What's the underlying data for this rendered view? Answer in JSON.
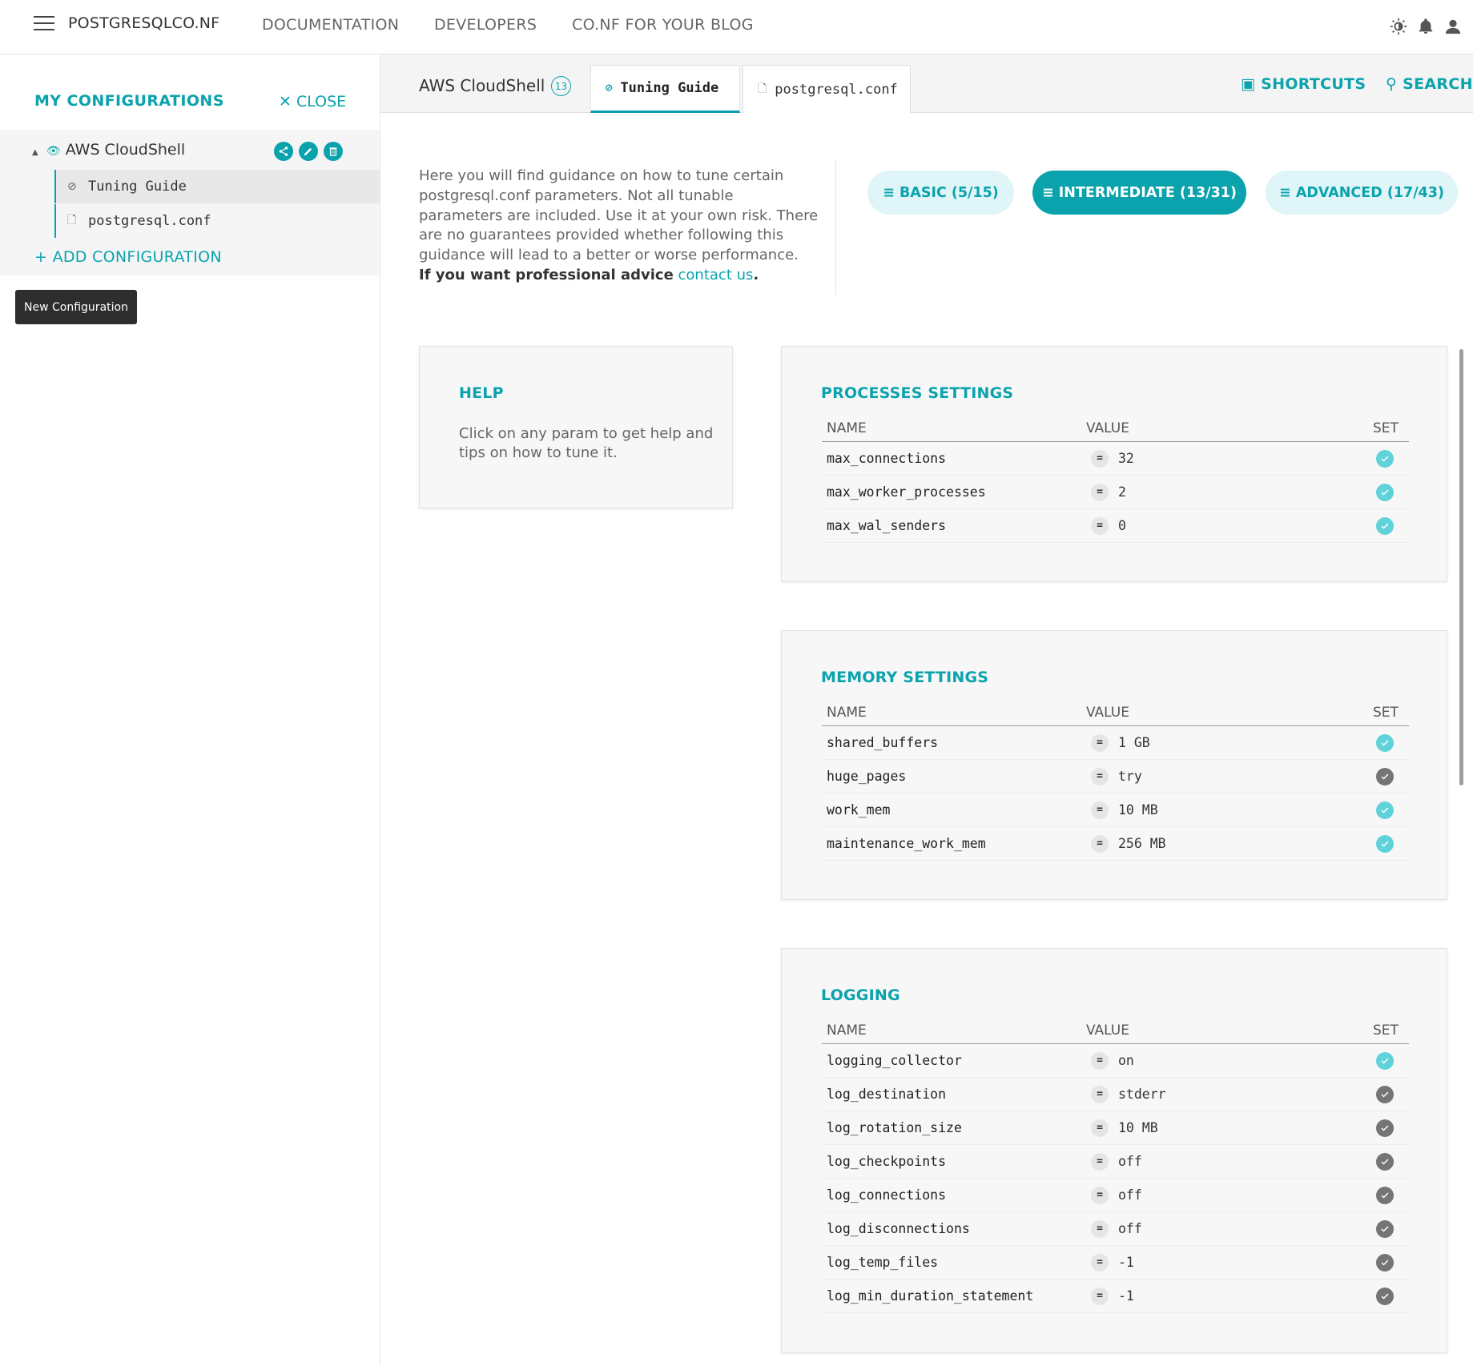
{
  "header": {
    "brand": "POSTGRESQLCO.NF",
    "nav": [
      "DOCUMENTATION",
      "DEVELOPERS",
      "CO.NF FOR YOUR BLOG"
    ]
  },
  "sidebar": {
    "title": "MY CONFIGURATIONS",
    "close_label": "CLOSE",
    "config_name": "AWS CloudShell",
    "children": [
      "Tuning Guide",
      "postgresql.conf"
    ],
    "add_label": "ADD CONFIGURATION",
    "tooltip": "New Configuration"
  },
  "tabs": {
    "config_title": "AWS CloudShell",
    "badge": "13",
    "items": [
      "Tuning Guide",
      "postgresql.conf"
    ],
    "shortcuts": "SHORTCUTS",
    "search": "SEARCH"
  },
  "intro": {
    "text": "Here you will find guidance on how to tune certain postgresql.conf parameters. Not all tunable parameters are included. Use it at your own risk. There are no guarantees provided whether following this guidance will lead to a better or worse performance.",
    "advice": "If you want professional advice",
    "contact": "contact us",
    "period": "."
  },
  "levels": [
    "BASIC (5/15)",
    "INTERMEDIATE (13/31)",
    "ADVANCED (17/43)"
  ],
  "help": {
    "title": "HELP",
    "text": "Click on any param to get help and tips on how to tune it."
  },
  "columns": {
    "name": "NAME",
    "value": "VALUE",
    "set": "SET"
  },
  "sections": [
    {
      "title": "PROCESSES SETTINGS",
      "rows": [
        {
          "name": "max_connections",
          "value": "32",
          "set": "teal"
        },
        {
          "name": "max_worker_processes",
          "value": "2",
          "set": "teal"
        },
        {
          "name": "max_wal_senders",
          "value": "0",
          "set": "teal"
        }
      ]
    },
    {
      "title": "MEMORY SETTINGS",
      "rows": [
        {
          "name": "shared_buffers",
          "value": "1 GB",
          "set": "teal"
        },
        {
          "name": "huge_pages",
          "value": "try",
          "set": "gray"
        },
        {
          "name": "work_mem",
          "value": "10 MB",
          "set": "teal"
        },
        {
          "name": "maintenance_work_mem",
          "value": "256 MB",
          "set": "teal"
        }
      ]
    },
    {
      "title": "LOGGING",
      "rows": [
        {
          "name": "logging_collector",
          "value": "on",
          "set": "teal"
        },
        {
          "name": "log_destination",
          "value": "stderr",
          "set": "gray"
        },
        {
          "name": "log_rotation_size",
          "value": "10 MB",
          "set": "gray"
        },
        {
          "name": "log_checkpoints",
          "value": "off",
          "set": "gray"
        },
        {
          "name": "log_connections",
          "value": "off",
          "set": "gray"
        },
        {
          "name": "log_disconnections",
          "value": "off",
          "set": "gray"
        },
        {
          "name": "log_temp_files",
          "value": "-1",
          "set": "gray"
        },
        {
          "name": "log_min_duration_statement",
          "value": "-1",
          "set": "gray"
        }
      ]
    }
  ],
  "colors": {
    "accent": "#0aa3ad",
    "set_active": "#5fd2da",
    "set_default": "#757575"
  }
}
